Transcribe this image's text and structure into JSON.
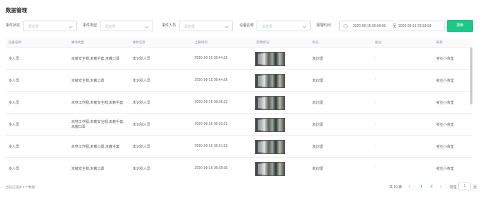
{
  "page": {
    "title": "数据管理"
  },
  "filters": {
    "event_status": {
      "label": "事件状态",
      "placeholder": "请选择"
    },
    "event_type": {
      "label": "事件类型",
      "placeholder": "请选择"
    },
    "event_person": {
      "label": "事件人员",
      "placeholder": "请选择"
    },
    "device_name": {
      "label": "设备名称",
      "placeholder": "请选择"
    },
    "alarm_time": {
      "label": "报警时间",
      "start": "2020-09-15 00:00:00",
      "separator": "至",
      "end": "2020-09-15 23:59:59"
    },
    "search_label": "搜索"
  },
  "table": {
    "columns": [
      "设备名称",
      "事件类型",
      "事件信息",
      "上报时间",
      "影像抓证",
      "状态",
      "备注",
      "来源"
    ],
    "rows": [
      {
        "device": "多人员",
        "type": "未戴安全帽,未戴手套,未戴口罩",
        "info": "未识别人员",
        "time": "2020-09-15 09:44:56",
        "status": "未处理",
        "remark": "-",
        "source": "考拉小食堂"
      },
      {
        "device": "多人员",
        "type": "未戴安全帽,未戴口罩",
        "info": "未识别人员",
        "time": "2020-09-15 09:44:56",
        "status": "未处理",
        "remark": "-",
        "source": "考拉小食堂"
      },
      {
        "device": "多人员",
        "type": "未穿工作服,未戴安全帽,未戴手套",
        "info": "未识别人员",
        "time": "2020-09-15 09:36:22",
        "status": "未处理",
        "remark": "-",
        "source": "考拉小食堂"
      },
      {
        "device": "多人员",
        "type": "未穿工作服,未戴安全帽,未戴手套,未戴口罩",
        "info": "未识别人员",
        "time": "2020-09-15 09:33:23",
        "status": "未处理",
        "remark": "-",
        "source": "考拉小食堂"
      },
      {
        "device": "多人员",
        "type": "未穿工作服,未戴口罩,未戴手套",
        "info": "未识别人员",
        "time": "2020-09-15 09:31:53",
        "status": "未处理",
        "remark": "-",
        "source": "考拉小食堂"
      },
      {
        "device": "多人员",
        "type": "未戴安全帽,未戴口罩",
        "info": "未识别人员",
        "time": "2020-09-15 09:30:39",
        "status": "未处理",
        "remark": "-",
        "source": "考拉小食堂"
      }
    ]
  },
  "footer": {
    "selected": "当前已选择 0 个数据",
    "total": "共 19 条",
    "pages": [
      "1",
      "2"
    ],
    "current_page": "1",
    "goto_label": "前往",
    "goto_value": "1",
    "goto_unit": "页",
    "prev": "‹",
    "next": "›"
  },
  "colors": {
    "accent": "#1ec68a",
    "header_bg": "#fafafa",
    "border": "#ebeef5"
  },
  "icons": {
    "select_arrow": "chevron-down-icon",
    "date": "calendar-icon"
  }
}
